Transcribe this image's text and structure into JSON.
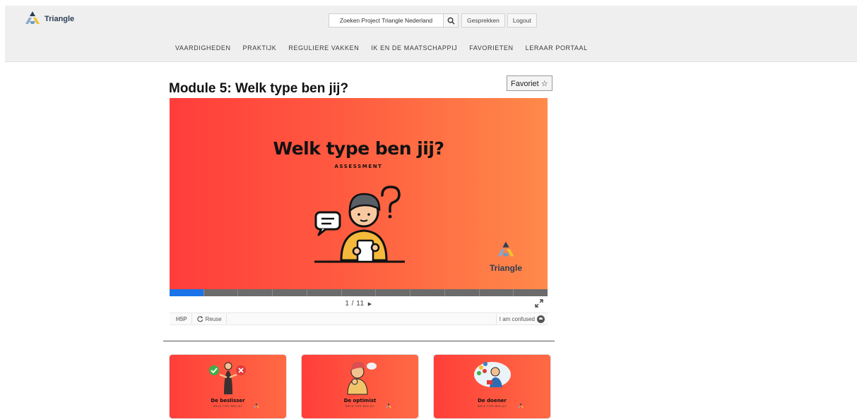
{
  "header": {
    "logo_text": "Triangle",
    "search_placeholder": "Zoeken Project Triangle Nederland",
    "conversations_label": "Gesprekken",
    "logout_label": "Logout",
    "nav": [
      "VAARDIGHEDEN",
      "PRAKTIJK",
      "REGULIERE VAKKEN",
      "IK EN DE MAATSCHAPPIJ",
      "FAVORIETEN",
      "LERAAR PORTAAL"
    ]
  },
  "page": {
    "title": "Module 5: Welk type ben jij?",
    "favorite_label": "Favoriet ☆"
  },
  "player": {
    "slide_title": "Welk type ben jij?",
    "slide_subtitle": "ASSESSMENT",
    "slide_logo_text": "Triangle",
    "counter": "1 / 11",
    "current_slide": 1,
    "total_slides": 11,
    "h5p_label": "H5P",
    "reuse_label": "Reuse",
    "confused_label": "I am confused"
  },
  "cards": [
    {
      "title": "De beslisser",
      "subtitle": "WELK TYPE BEN JIJ?"
    },
    {
      "title": "De optimist",
      "subtitle": "WELK TYPE BEN JIJ?"
    },
    {
      "title": "De doener",
      "subtitle": "WELK TYPE BEN JIJ?"
    }
  ],
  "colors": {
    "slide_gradient_start": "#ff3d3b",
    "slide_gradient_end": "#ff8a4a",
    "progress_active": "#1a73e8",
    "header_bg": "#efefef"
  },
  "icons": [
    "triangle-logo-icon",
    "search-icon",
    "reuse-icon",
    "fullscreen-icon",
    "confused-icon",
    "next-arrow-icon"
  ]
}
